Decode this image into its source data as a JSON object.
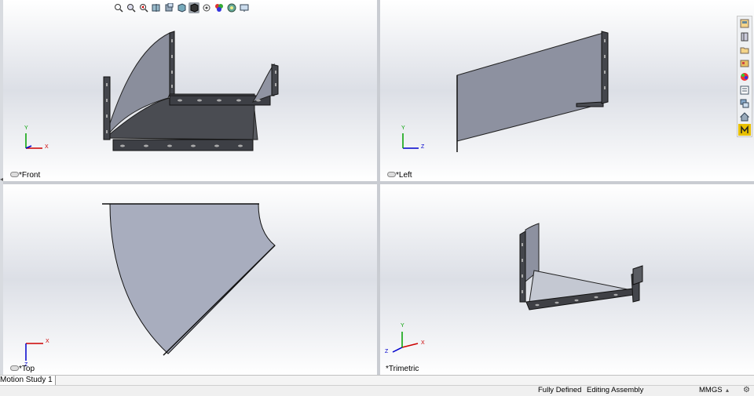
{
  "viewports": {
    "front": {
      "label": "*Front",
      "axis_h": "X",
      "axis_v": "Y"
    },
    "left": {
      "label": "*Left",
      "axis_h": "Z",
      "axis_v": "Y"
    },
    "top": {
      "label": "*Top",
      "axis_h": "X",
      "axis_v": "Z"
    },
    "trimetric": {
      "label": "*Trimetric",
      "axis_a": "X",
      "axis_b": "Z",
      "axis_v": "Y"
    }
  },
  "toolbar": {
    "icons": [
      "zoom-to-fit-icon",
      "zoom-to-area-icon",
      "previous-view-icon",
      "section-view-icon",
      "dynamic-annotation-icon",
      "view-orientation-icon",
      "display-style-icon",
      "hide-show-items-icon",
      "edit-appearance-icon",
      "apply-scene-icon",
      "view-settings-icon"
    ]
  },
  "taskpane": {
    "icons": [
      "solidworks-resources-icon",
      "design-library-icon",
      "file-explorer-icon",
      "view-palette-icon",
      "appearances-icon",
      "custom-properties-icon",
      "solidworks-forum-icon",
      "home-icon",
      "m-icon"
    ]
  },
  "tabs": {
    "motion_study": "Motion Study 1"
  },
  "status": {
    "defined": "Fully Defined",
    "mode": "Editing Assembly",
    "units": "MMGS"
  },
  "colors": {
    "part_fill": "#8c909e",
    "part_dark": "#3f4045",
    "x_axis": "#cc0000",
    "y_axis": "#00a000",
    "z_axis": "#0000cc"
  }
}
